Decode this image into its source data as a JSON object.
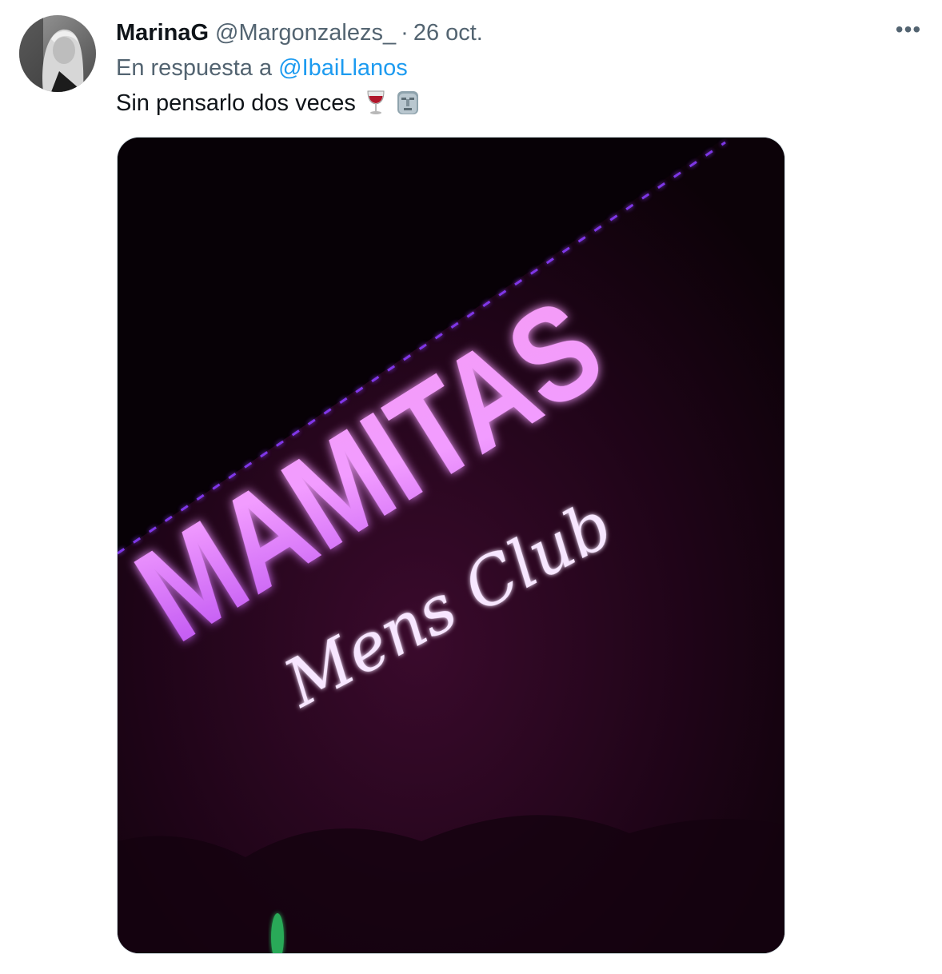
{
  "tweet": {
    "author": {
      "display_name": "MarinaG",
      "handle": "@Margonzalezs_",
      "avatar_icon": "profile-avatar"
    },
    "separator": "·",
    "date": "26 oct.",
    "more_icon": "ellipsis-icon",
    "more_label": "•••",
    "reply_prefix": "En respuesta a",
    "reply_to": "@IbaiLlanos",
    "text": "Sin pensarlo dos veces",
    "emojis": [
      "wine-glass-icon",
      "moai-icon"
    ],
    "media": {
      "sign_title": "MAMITAS",
      "sign_subtitle": "Mens Club"
    }
  },
  "colors": {
    "link": "#1d9bf0",
    "secondary_text": "#536471",
    "primary_text": "#0f1419",
    "neon_pink": "#f28cff",
    "neon_purple": "#9b3cff"
  }
}
